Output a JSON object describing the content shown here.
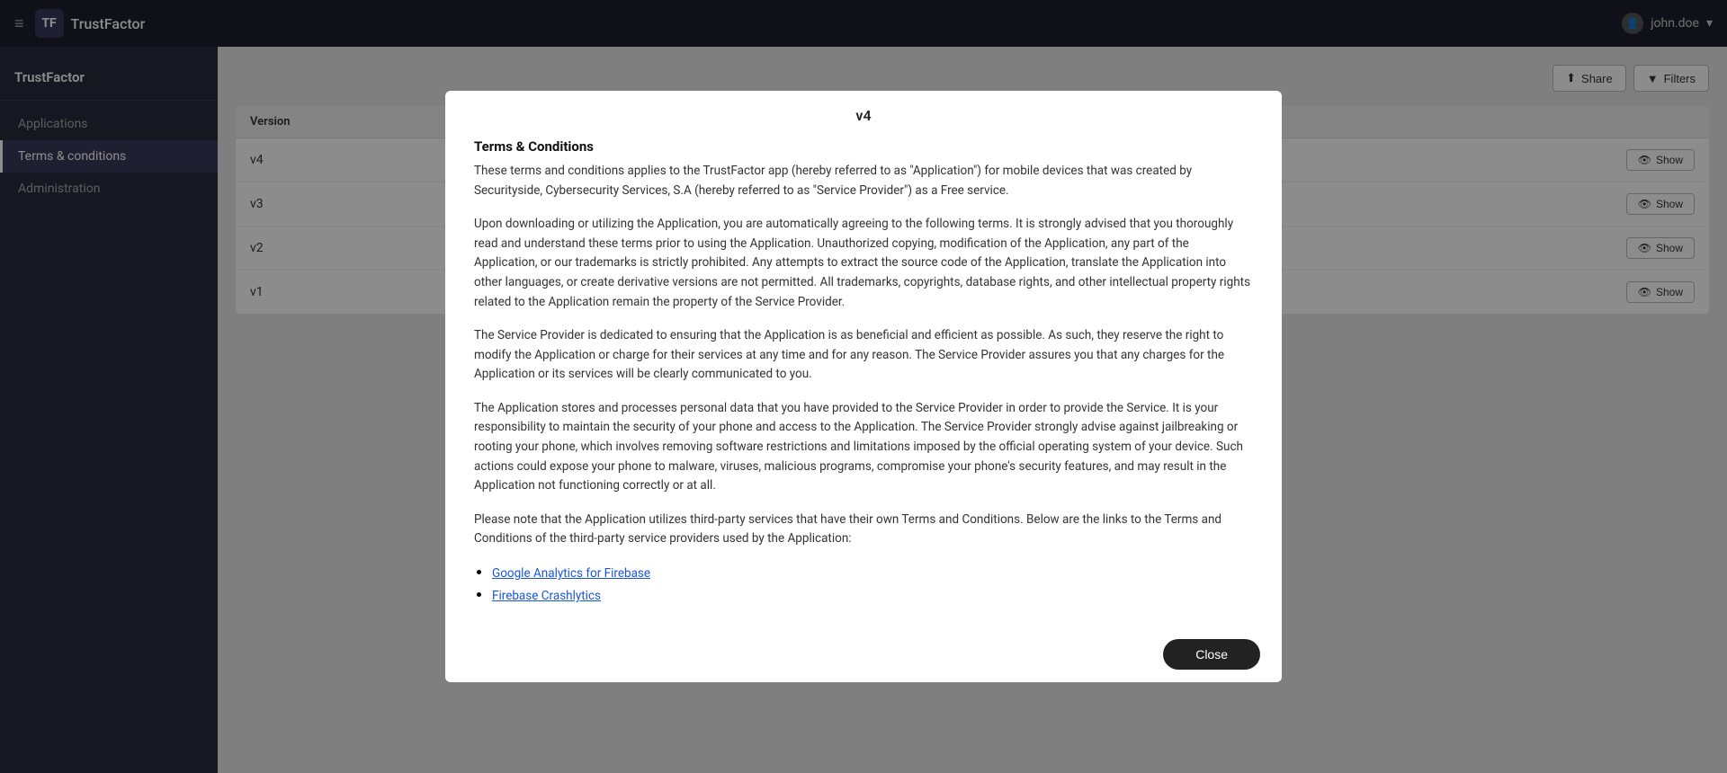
{
  "navbar": {
    "hamburger": "≡",
    "brand_logo": "TF",
    "brand_name": "TrustFactor",
    "user_name": "john.doe",
    "user_chevron": "▾"
  },
  "sidebar": {
    "app_section_name": "TrustFactor",
    "items": [
      {
        "id": "applications",
        "label": "Applications",
        "active": false
      },
      {
        "id": "terms",
        "label": "Terms & conditions",
        "active": true
      },
      {
        "id": "administration",
        "label": "Administration",
        "active": false
      }
    ]
  },
  "main": {
    "toolbar": {
      "share_label": "Share",
      "filters_label": "Filters"
    },
    "table": {
      "header": "Version",
      "rows": [
        {
          "version": "v4"
        },
        {
          "version": "v3"
        },
        {
          "version": "v2"
        },
        {
          "version": "v1"
        }
      ],
      "show_label": "Show"
    }
  },
  "modal": {
    "title_version": "v4",
    "section_heading": "Terms & Conditions",
    "paragraph1": "These terms and conditions applies to the TrustFactor app (hereby referred to as \"Application\") for mobile devices that was created by Securityside, Cybersecurity Services, S.A (hereby referred to as \"Service Provider\") as a Free service.",
    "paragraph2": "Upon downloading or utilizing the Application, you are automatically agreeing to the following terms. It is strongly advised that you thoroughly read and understand these terms prior to using the Application. Unauthorized copying, modification of the Application, any part of the Application, or our trademarks is strictly prohibited. Any attempts to extract the source code of the Application, translate the Application into other languages, or create derivative versions are not permitted. All trademarks, copyrights, database rights, and other intellectual property rights related to the Application remain the property of the Service Provider.",
    "paragraph3": "The Service Provider is dedicated to ensuring that the Application is as beneficial and efficient as possible. As such, they reserve the right to modify the Application or charge for their services at any time and for any reason. The Service Provider assures you that any charges for the Application or its services will be clearly communicated to you.",
    "paragraph4": "The Application stores and processes personal data that you have provided to the Service Provider in order to provide the Service. It is your responsibility to maintain the security of your phone and access to the Application. The Service Provider strongly advise against jailbreaking or rooting your phone, which involves removing software restrictions and limitations imposed by the official operating system of your device. Such actions could expose your phone to malware, viruses, malicious programs, compromise your phone's security features, and may result in the Application not functioning correctly or at all.",
    "paragraph5": "Please note that the Application utilizes third-party services that have their own Terms and Conditions. Below are the links to the Terms and Conditions of the third-party service providers used by the Application:",
    "links": [
      {
        "label": "Google Analytics for Firebase",
        "url": "#"
      },
      {
        "label": "Firebase Crashlytics",
        "url": "#"
      }
    ],
    "close_label": "Close"
  }
}
